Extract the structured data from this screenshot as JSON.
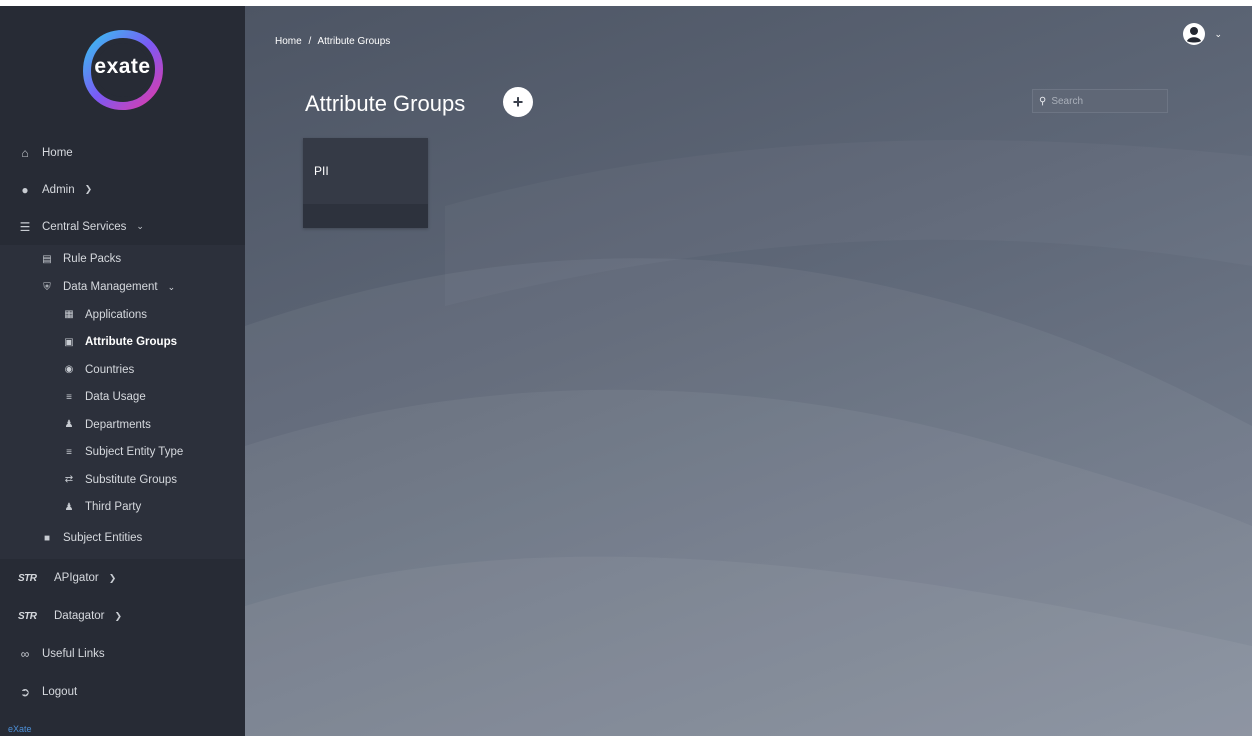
{
  "brand": {
    "logo_text": "exate",
    "footer": "eXate"
  },
  "sidebar": {
    "items": [
      {
        "label": "Home",
        "icon": "home-icon"
      },
      {
        "label": "Admin",
        "icon": "users-cog-icon"
      },
      {
        "label": "Central Services",
        "icon": "layers-icon"
      }
    ],
    "central_services": [
      {
        "label": "Rule Packs",
        "icon": "list-alt-icon"
      },
      {
        "label": "Data Management",
        "icon": "shield-icon"
      }
    ],
    "data_management": [
      {
        "label": "Applications",
        "icon": "grid-icon"
      },
      {
        "label": "Attribute Groups",
        "icon": "id-card-icon",
        "active": true
      },
      {
        "label": "Countries",
        "icon": "globe-icon"
      },
      {
        "label": "Data Usage",
        "icon": "sliders-icon"
      },
      {
        "label": "Departments",
        "icon": "user-tie-icon"
      },
      {
        "label": "Subject Entity Type",
        "icon": "list-icon"
      },
      {
        "label": "Substitute Groups",
        "icon": "exchange-icon"
      },
      {
        "label": "Third Party",
        "icon": "users-icon"
      }
    ],
    "subject_entities": {
      "label": "Subject Entities",
      "icon": "book-icon"
    },
    "bottom": [
      {
        "label": "APIgator",
        "icon": "apigator-logo-icon"
      },
      {
        "label": "Datagator",
        "icon": "datagator-logo-icon"
      },
      {
        "label": "Useful Links",
        "icon": "link-icon"
      },
      {
        "label": "Logout",
        "icon": "sign-out-icon"
      }
    ]
  },
  "breadcrumb": {
    "home": "Home",
    "separator": "/",
    "current": "Attribute Groups"
  },
  "page": {
    "title": "Attribute Groups",
    "add_label": "+"
  },
  "search": {
    "placeholder": "Search"
  },
  "cards": [
    {
      "title": "PII"
    }
  ],
  "colors": {
    "sidebar_bg": "#272b35",
    "accent": "#4d8fd6",
    "card_bg": "#353a46"
  }
}
